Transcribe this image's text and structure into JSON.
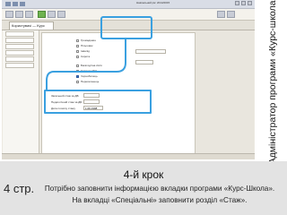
{
  "app": {
    "tab_label": "Користувачі — Курс",
    "titlebar_info": "Навчальний рік: 2014/2015"
  },
  "form": {
    "checkboxes": [
      {
        "label": "Громадянин",
        "checked": false
      },
      {
        "label": "Пільговик",
        "checked": false
      },
      {
        "label": "Інвалід",
        "checked": false
      },
      {
        "label": "Сирота",
        "checked": false
      },
      {
        "label": "Багатодітна сім'я",
        "checked": false
      },
      {
        "label": "Учасник АТО",
        "checked": false
      },
      {
        "label": "Чорнобилець",
        "checked": true
      },
      {
        "label": "Переселенець",
        "checked": false
      }
    ],
    "stazh_rows": [
      {
        "label": "Загальний стаж за ДБ"
      },
      {
        "label": "Педагогічний стаж за ДБ"
      },
      {
        "label": "Дата початку стажу"
      }
    ],
    "stazh_value": "1.09.1998"
  },
  "vertical_caption": "Адміністратор програми «Курс-школа»",
  "slide": {
    "page_label": "4 стр.",
    "step_title": "4-й крок",
    "line1": "Потрібно заповнити інформацією вкладки програми «Курс-Школа».",
    "line2": "На вкладці «Спеціальні» заповнити розділ «Стаж»."
  }
}
